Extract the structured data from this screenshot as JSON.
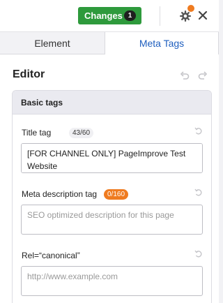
{
  "toolbar": {
    "changes_label": "Changes",
    "changes_count": "1",
    "notification_color": "#ef7b20",
    "icons": [
      "gear-icon",
      "close-icon"
    ]
  },
  "tabs": [
    {
      "label": "Element",
      "active": false
    },
    {
      "label": "Meta Tags",
      "active": true
    }
  ],
  "editor": {
    "title": "Editor",
    "icons": [
      "undo-icon",
      "redo-icon"
    ],
    "section": {
      "title": "Basic tags",
      "fields": [
        {
          "label": "Title tag",
          "counter": "43/60",
          "value": "[FOR CHANNEL ONLY] PageImprove Test Website",
          "placeholder": ""
        },
        {
          "label": "Meta description tag",
          "counter": "0/160",
          "value": "",
          "placeholder": "SEO optimized description for this page"
        },
        {
          "label": "Rel=“canonical”",
          "value": "",
          "placeholder": "http://www.example.com"
        }
      ]
    }
  },
  "colors": {
    "accent_blue": "#1f5fbf",
    "changes_green": "#2e9a3c",
    "counter_orange": "#ef7b20"
  }
}
